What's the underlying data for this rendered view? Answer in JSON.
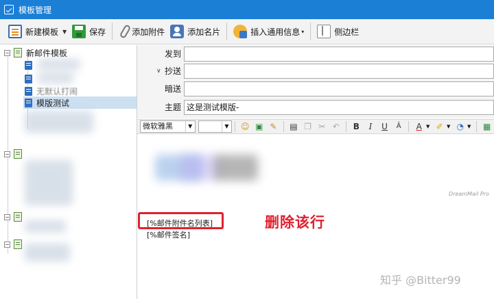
{
  "window": {
    "title": "模板管理"
  },
  "toolbar": {
    "new_template": "新建模板",
    "save": "保存",
    "add_attachment": "添加附件",
    "add_card": "添加名片",
    "insert_info": "插入通用信息",
    "sidebar": "侧边栏"
  },
  "tree": {
    "root_label": "新邮件模板",
    "partial_item": "无默认打闹",
    "selected_item": "模版测试"
  },
  "fields": {
    "to_label": "发到",
    "cc_label": "抄送",
    "bcc_label": "暗送",
    "subject_label": "主题",
    "subject_value": "这是测试模版-"
  },
  "editor_toolbar": {
    "font_name": "微软雅黑",
    "bold": "B",
    "italic": "I",
    "underline": "U"
  },
  "editor": {
    "signature_line1": "[%邮件附件名列表]",
    "signature_line2": "[%邮件签名]"
  },
  "annotation": {
    "text": "删除该行"
  },
  "watermark": {
    "text": "知乎 @Bitter99"
  },
  "brand": {
    "text": "DreamMail Pro"
  },
  "colors": {
    "titlebar": "#1c7fd6",
    "annotation": "#e0202e",
    "selected_row": "#cde0f2"
  }
}
